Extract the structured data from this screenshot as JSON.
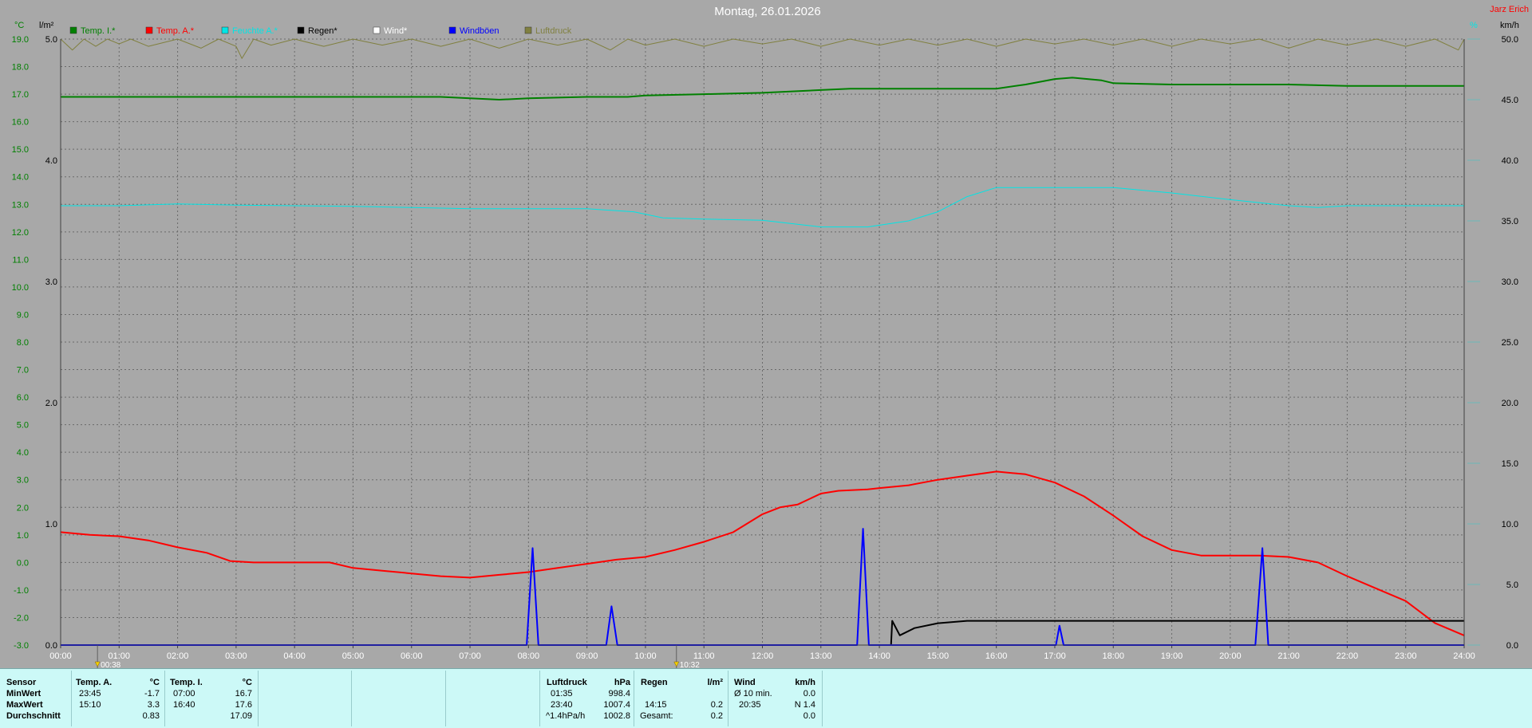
{
  "title": "Montag, 26.01.2026",
  "station": "Jarz Erich",
  "units": {
    "temp": "°C",
    "rain": "l/m²",
    "humidity": "%",
    "wind": "km/h"
  },
  "legend": [
    {
      "name": "Temp. I.*",
      "color": "#008000"
    },
    {
      "name": "Temp. A.*",
      "color": "#ff0000"
    },
    {
      "name": "Feuchte A.*",
      "color": "#00e5e5"
    },
    {
      "name": "Regen*",
      "color": "#000000"
    },
    {
      "name": "Wind*",
      "color": "#ffffff"
    },
    {
      "name": "Windböen",
      "color": "#0000ff"
    },
    {
      "name": "Luftdruck",
      "color": "#808040"
    }
  ],
  "markers": [
    {
      "x": 0.63,
      "label": "00:38"
    },
    {
      "x": 10.53,
      "label": "10:32"
    }
  ],
  "chart_data": {
    "type": "line",
    "title": "Montag, 26.01.2026",
    "x_ticks": [
      "00:00",
      "01:00",
      "02:00",
      "03:00",
      "04:00",
      "05:00",
      "06:00",
      "07:00",
      "08:00",
      "09:00",
      "10:00",
      "11:00",
      "12:00",
      "13:00",
      "14:00",
      "15:00",
      "16:00",
      "17:00",
      "18:00",
      "19:00",
      "20:00",
      "21:00",
      "22:00",
      "23:00",
      "24:00"
    ],
    "xlim": [
      0,
      24
    ],
    "left_axis": {
      "unit": "°C",
      "ylim": [
        -3,
        19
      ],
      "ticks": [
        "19.0",
        "18.0",
        "17.0",
        "16.0",
        "15.0",
        "14.0",
        "13.0",
        "12.0",
        "11.0",
        "10.0",
        "9.0",
        "8.0",
        "7.0",
        "6.0",
        "5.0",
        "4.0",
        "3.0",
        "2.0",
        "1.0",
        "0.0",
        "-1.0",
        "-2.0",
        "-3.0"
      ]
    },
    "rain_axis": {
      "unit": "l/m²",
      "ylim": [
        0,
        5
      ],
      "ticks": [
        "5.0",
        "4.0",
        "3.0",
        "2.0",
        "1.0",
        "0.0"
      ]
    },
    "wind_axis": {
      "unit": "km/h",
      "ylim": [
        0,
        50
      ],
      "ticks": [
        "50.0",
        "45.0",
        "40.0",
        "35.0",
        "30.0",
        "25.0",
        "20.0",
        "15.0",
        "10.0",
        "5.0",
        "0.0"
      ]
    },
    "humidity_axis": {
      "unit": "%",
      "ylim": [
        0,
        100
      ]
    },
    "grid": true,
    "series": [
      {
        "name": "Temp. I.*",
        "axis": "temp",
        "color": "#008000",
        "x": [
          0,
          3,
          5,
          6.5,
          7,
          7.5,
          8,
          9,
          9.7,
          10,
          11,
          12,
          13,
          13.5,
          14,
          15,
          16,
          16.5,
          17,
          17.3,
          17.8,
          18,
          19,
          20,
          21,
          22,
          23,
          23.5,
          24
        ],
        "y": [
          16.9,
          16.9,
          16.9,
          16.9,
          16.85,
          16.8,
          16.85,
          16.9,
          16.9,
          16.95,
          17.0,
          17.05,
          17.15,
          17.2,
          17.2,
          17.2,
          17.2,
          17.35,
          17.55,
          17.6,
          17.5,
          17.4,
          17.35,
          17.35,
          17.35,
          17.3,
          17.3,
          17.3,
          17.3
        ]
      },
      {
        "name": "Temp. A.*",
        "axis": "temp",
        "color": "#ff0000",
        "x": [
          0,
          0.5,
          1,
          1.5,
          2,
          2.5,
          2.9,
          3.3,
          4,
          4.6,
          5,
          5.5,
          6,
          6.5,
          7,
          7.5,
          8,
          8.5,
          9,
          9.5,
          10,
          10.5,
          11,
          11.5,
          12,
          12.3,
          12.6,
          13,
          13.3,
          13.8,
          14,
          14.5,
          15,
          15.5,
          16,
          16.5,
          17,
          17.5,
          18,
          18.5,
          19,
          19.5,
          20,
          20.5,
          21,
          21.5,
          22,
          22.5,
          23,
          23.5,
          24
        ],
        "y": [
          1.1,
          1.0,
          0.95,
          0.8,
          0.55,
          0.35,
          0.05,
          0.0,
          0.0,
          0.0,
          -0.2,
          -0.3,
          -0.4,
          -0.5,
          -0.55,
          -0.45,
          -0.35,
          -0.2,
          -0.05,
          0.1,
          0.2,
          0.45,
          0.75,
          1.1,
          1.75,
          2.0,
          2.1,
          2.5,
          2.6,
          2.65,
          2.7,
          2.8,
          3.0,
          3.15,
          3.3,
          3.2,
          2.9,
          2.4,
          1.7,
          0.95,
          0.45,
          0.25,
          0.25,
          0.25,
          0.2,
          0.0,
          -0.5,
          -0.95,
          -1.4,
          -2.2,
          -2.65
        ]
      },
      {
        "name": "Feuchte A.*",
        "axis": "humidity",
        "color": "#00e5e5",
        "x": [
          0,
          1,
          2,
          3,
          4,
          5,
          6,
          7,
          8,
          9,
          9.8,
          10.3,
          11,
          12,
          13,
          13.8,
          14.5,
          15,
          15.5,
          16,
          16.5,
          17,
          18,
          19,
          20,
          21,
          21.5,
          22,
          23,
          24
        ],
        "y": [
          72.5,
          72.5,
          72.8,
          72.6,
          72.5,
          72.4,
          72.2,
          72.0,
          72.0,
          72.0,
          71.5,
          70.5,
          70.3,
          70.1,
          69.0,
          69.0,
          70.0,
          71.5,
          74.0,
          75.5,
          75.5,
          75.5,
          75.5,
          74.6,
          73.5,
          72.5,
          72.2,
          72.5,
          72.5,
          72.5
        ]
      },
      {
        "name": "Regen*",
        "axis": "rain",
        "color": "#000000",
        "x": [
          14.2,
          14.22,
          14.35,
          14.6,
          15,
          15.5,
          16,
          17,
          18,
          19,
          20,
          21,
          22,
          23,
          24
        ],
        "y": [
          0,
          0.2,
          0.08,
          0.14,
          0.18,
          0.2,
          0.2,
          0.2,
          0.2,
          0.2,
          0.2,
          0.2,
          0.2,
          0.2,
          0.2
        ]
      },
      {
        "name": "Windböen",
        "axis": "wind",
        "color": "#0000ff",
        "x": [
          0,
          7.97,
          8.07,
          8.17,
          9.33,
          9.42,
          9.52,
          13.62,
          13.72,
          13.82,
          17.02,
          17.08,
          17.15,
          20.43,
          20.55,
          20.65,
          24
        ],
        "y": [
          0,
          0,
          8,
          0,
          0,
          3.2,
          0,
          0,
          9.6,
          0,
          0,
          1.6,
          0,
          0,
          8,
          0,
          0
        ]
      },
      {
        "name": "Luftdruck",
        "axis": "humidity",
        "color": "#808040",
        "x": [
          0,
          0.2,
          0.4,
          0.6,
          0.8,
          1,
          1.2,
          1.5,
          2,
          2.4,
          2.7,
          3,
          3.1,
          3.3,
          3.6,
          4,
          4.5,
          5,
          5.5,
          6,
          6.5,
          7,
          7.5,
          8,
          8.5,
          9,
          9.4,
          9.7,
          10,
          10.5,
          11,
          11.5,
          12,
          12.5,
          13,
          13.5,
          14,
          14.5,
          15,
          15.5,
          16,
          16.5,
          17,
          17.5,
          18,
          18.5,
          19,
          19.5,
          20,
          20.5,
          21,
          21.5,
          22,
          22.5,
          23,
          23.5,
          23.9,
          24
        ],
        "y": [
          100,
          98.2,
          100,
          98.8,
          100,
          99.2,
          100,
          98.8,
          100,
          98.5,
          100,
          98.8,
          96.8,
          100,
          99,
          100,
          98.8,
          100,
          99,
          100,
          98.8,
          100,
          98.5,
          100,
          99,
          100,
          98.2,
          100,
          99,
          100,
          98.8,
          100,
          99.2,
          100,
          98.8,
          100,
          99,
          100,
          99,
          100,
          98.8,
          100,
          99.2,
          100,
          99,
          100,
          98.8,
          100,
          99.2,
          100,
          98.5,
          100,
          99,
          100,
          98.8,
          100,
          98.2,
          100
        ]
      }
    ]
  },
  "stats": {
    "row_labels": [
      "Sensor",
      "MinWert",
      "MaxWert",
      "Durchschnitt"
    ],
    "temp_a": {
      "label": "Temp. A.",
      "unit": "°C",
      "min_time": "23:45",
      "min": "-1.7",
      "max_time": "15:10",
      "max": "3.3",
      "avg": "0.83"
    },
    "temp_i": {
      "label": "Temp. I.",
      "unit": "°C",
      "min_time": "07:00",
      "min": "16.7",
      "max_time": "16:40",
      "max": "17.6",
      "avg": "17.09"
    },
    "pressure": {
      "label": "Luftdruck",
      "unit": "hPa",
      "min_time": "01:35",
      "min": "998.4",
      "max_time": "23:40",
      "max": "1007.4",
      "trend": "^1.4hPa/h",
      "current": "1002.8"
    },
    "rain": {
      "label": "Regen",
      "unit": "l/m²",
      "max_time": "14:15",
      "max": "0.2",
      "total_label": "Gesamt:",
      "total": "0.2"
    },
    "wind": {
      "label": "Wind",
      "unit": "km/h",
      "avg10_label": "Ø 10 min.",
      "avg10": "0.0",
      "max_time": "20:35",
      "max": "N 1.4",
      "avg": "0.0"
    }
  }
}
